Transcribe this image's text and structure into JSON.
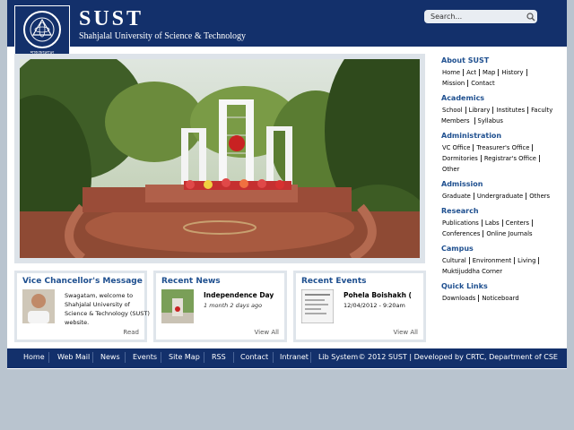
{
  "header": {
    "title": "SUST",
    "tagline": "Shahjalal University of Science & Technology",
    "search_placeholder": "Search...",
    "logo_caption": "শাহজালাল"
  },
  "boxes": {
    "vc": {
      "title": "Vice Chancellor's Message",
      "text": "Swagatam, welcome to Shahjalal University of Science & Technology (SUST) website.",
      "link": "Read"
    },
    "news": {
      "title": "Recent News",
      "item_title": "Independence Day",
      "item_meta": "1 month 2 days ago",
      "link": "View All"
    },
    "events": {
      "title": "Recent Events",
      "item_title": "Pohela Boishakh (",
      "item_meta": "12/04/2012 - 9:20am",
      "link": "View All"
    }
  },
  "sidebar": {
    "about": {
      "title": "About SUST",
      "links": [
        "Home",
        "Act",
        "Map",
        "History",
        "Mission",
        "Contact"
      ]
    },
    "academics": {
      "title": "Academics",
      "links": [
        "School",
        "Library",
        "Institutes",
        "Faculty Members",
        "Syllabus"
      ]
    },
    "administration": {
      "title": "Administration",
      "links": [
        "VC Office",
        "Treasurer's Office",
        "Dormitories",
        "Registrar's Office",
        "Other"
      ]
    },
    "admission": {
      "title": "Admission",
      "links": [
        "Graduate",
        "Undergraduate",
        "Others"
      ]
    },
    "research": {
      "title": "Research",
      "links": [
        "Publications",
        "Labs",
        "Centers",
        "Conferences",
        "Online Journals"
      ]
    },
    "campus": {
      "title": "Campus",
      "links": [
        "Cultural",
        "Environment",
        "Living",
        "Muktijuddha Corner"
      ]
    },
    "quick": {
      "title": "Quick Links",
      "links": [
        "Downloads",
        "Noticeboard"
      ]
    }
  },
  "footer": {
    "links": [
      "Home",
      "Web Mail",
      "News",
      "Events",
      "Site Map",
      "RSS",
      "Contact",
      "Intranet",
      "Lib System"
    ],
    "copyright": "© 2012 SUST | Developed by CRTC, Department of CSE"
  },
  "colors": {
    "header_bg": "#13306b",
    "accent": "#1e4f8f",
    "page_bg": "#b9c4cf"
  }
}
